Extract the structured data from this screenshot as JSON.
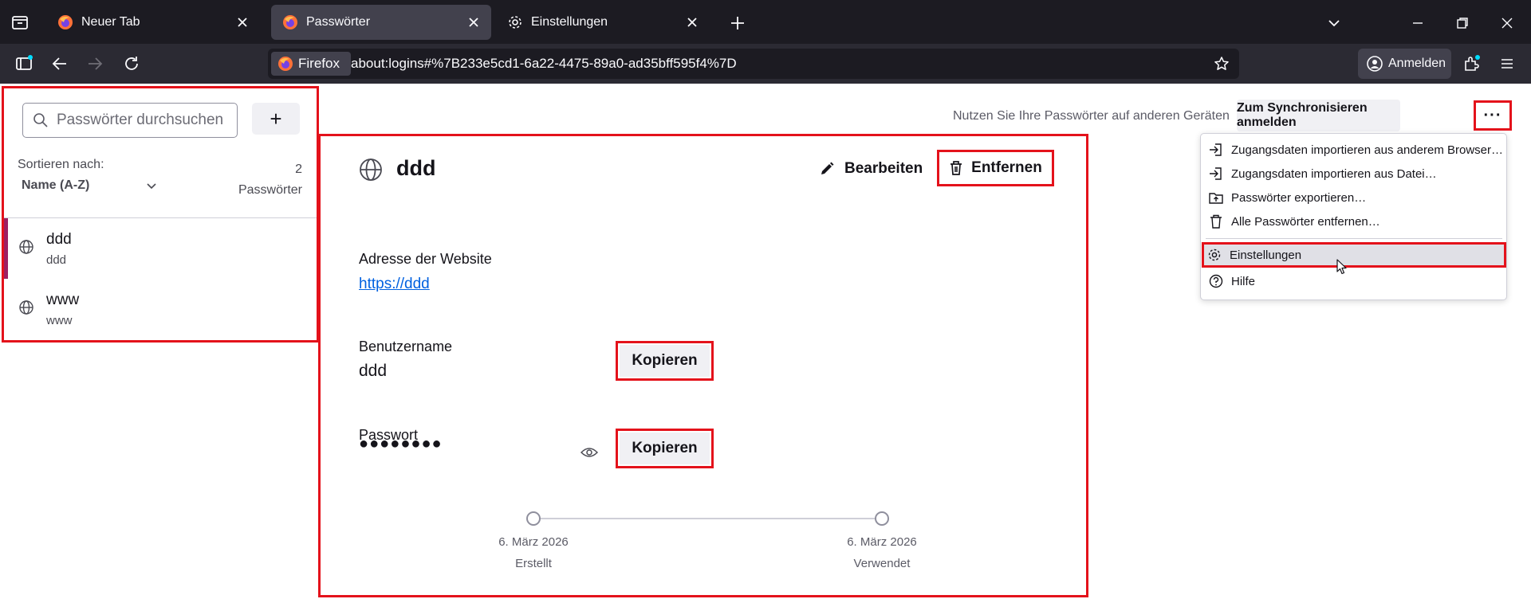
{
  "tabs": [
    {
      "label": "Neuer Tab",
      "active": false
    },
    {
      "label": "Passwörter",
      "active": true
    },
    {
      "label": "Einstellungen",
      "active": false
    }
  ],
  "navbar": {
    "identity_label": "Firefox",
    "url": "about:logins#%7B233e5cd1-6a22-4475-89a0-ad35bff595f4%7D",
    "signin_label": "Anmelden"
  },
  "sidebar": {
    "search_placeholder": "Passwörter durchsuchen",
    "add_label": "+",
    "sort_label": "Sortieren nach:",
    "sort_value": "Name (A-Z)",
    "count": "2",
    "count_label": "Passwörter",
    "logins": [
      {
        "title": "ddd",
        "subtitle": "ddd"
      },
      {
        "title": "www",
        "subtitle": "www"
      }
    ]
  },
  "detail": {
    "title": "ddd",
    "edit_label": "Bearbeiten",
    "remove_label": "Entfernen",
    "website_label": "Adresse der Website",
    "website_value": "https://ddd",
    "username_label": "Benutzername",
    "username_value": "ddd",
    "password_label": "Passwort",
    "password_value": "●●●●●●●●",
    "copy_label": "Kopieren",
    "created_date": "6. März 2026",
    "created_label": "Erstellt",
    "used_date": "6. März 2026",
    "used_label": "Verwendet"
  },
  "header": {
    "sync_text": "Nutzen Sie Ihre Passwörter auf anderen Geräten",
    "sync_button": "Zum Synchronisieren anmelden",
    "menu_label": "···"
  },
  "menu": {
    "items": [
      "Zugangsdaten importieren aus anderem Browser…",
      "Zugangsdaten importieren aus Datei…",
      "Passwörter exportieren…",
      "Alle Passwörter entfernen…",
      "Einstellungen",
      "Hilfe"
    ]
  },
  "colors": {
    "highlight": "#e4121b",
    "selected_accent": "#9e1f63",
    "link": "#0061e0",
    "chrome_dark": "#1c1b22"
  }
}
